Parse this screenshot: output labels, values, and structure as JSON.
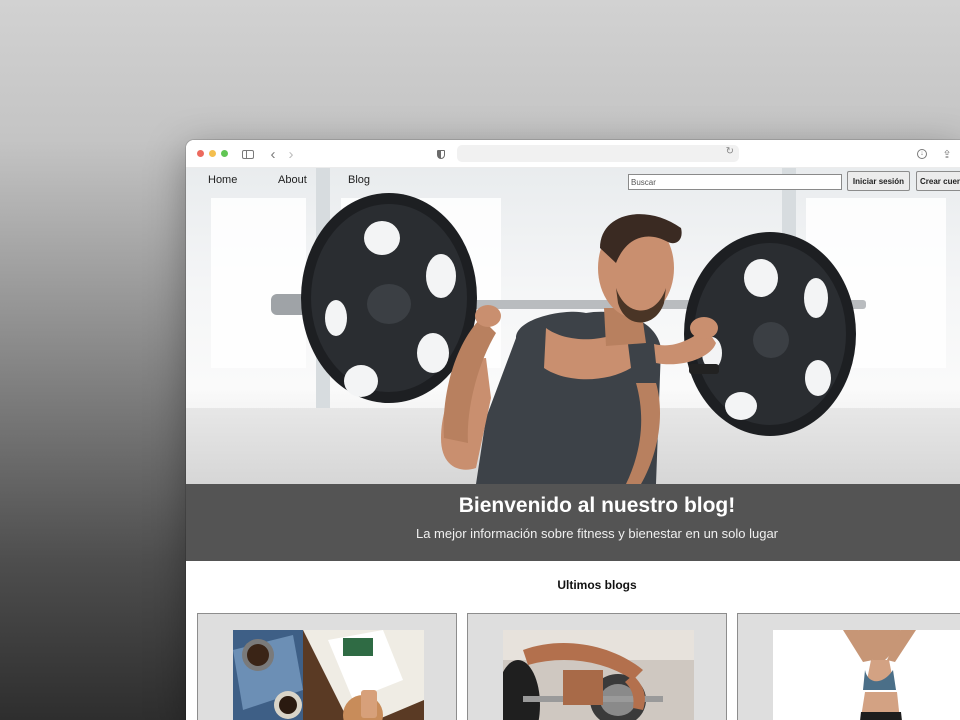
{
  "browser": {
    "url": ""
  },
  "nav": {
    "links": [
      {
        "label": "Home"
      },
      {
        "label": "About"
      },
      {
        "label": "Blog"
      }
    ],
    "search_placeholder": "Buscar",
    "login_label": "Iniciar sesión",
    "signup_label": "Crear cuenta"
  },
  "hero": {
    "image": "man-lifting-barbell-squat",
    "title": "Bienvenido al nuestro blog!",
    "subtitle": "La mejor información sobre fitness y bienestar en un solo lugar"
  },
  "latest": {
    "heading": "Ultimos blogs",
    "cards": [
      {
        "image": "coffee-magazine-table"
      },
      {
        "image": "weightlifting-barbell-gym"
      },
      {
        "image": "woman-fitness-pose"
      }
    ]
  },
  "colors": {
    "banner": "#545454",
    "card_bg": "#dedede",
    "page_bg": "#ffffff"
  }
}
